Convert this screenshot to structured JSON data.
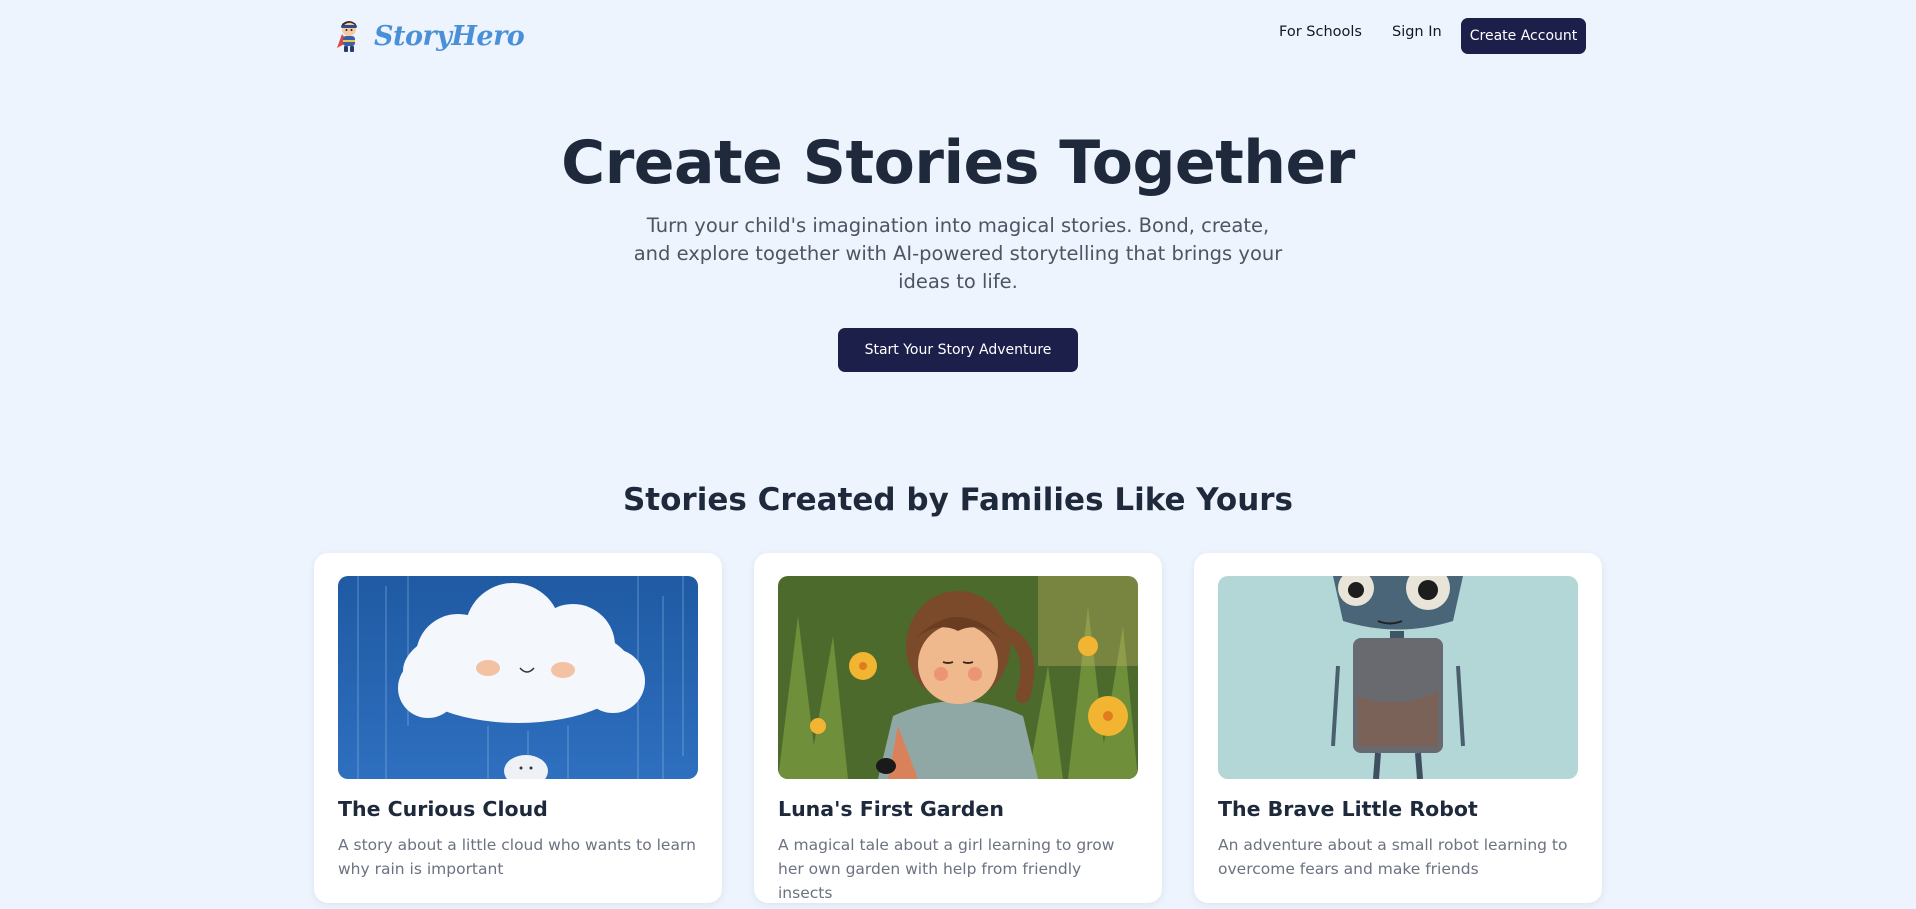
{
  "nav": {
    "brand": "StoryHero",
    "for_schools": "For Schools",
    "sign_in": "Sign In",
    "create_account": "Create Account"
  },
  "hero": {
    "title": "Create Stories Together",
    "subtitle": "Turn your child's imagination into magical stories. Bond, create, and explore together with AI-powered storytelling that brings your ideas to life.",
    "cta": "Start Your Story Adventure"
  },
  "stories_section": {
    "heading": "Stories Created by Families Like Yours",
    "cards": [
      {
        "title": "The Curious Cloud",
        "description": "A story about a little cloud who wants to learn why rain is important",
        "image": "cloud-illustration"
      },
      {
        "title": "Luna's First Garden",
        "description": "A magical tale about a girl learning to grow her own garden with help from friendly insects",
        "image": "girl-garden-illustration"
      },
      {
        "title": "The Brave Little Robot",
        "description": "An adventure about a small robot learning to overcome fears and make friends",
        "image": "robot-illustration"
      }
    ]
  },
  "colors": {
    "background": "#eef4fd",
    "primary_button": "#1b1f4a",
    "brand": "#4a90d9",
    "heading": "#1e293b",
    "muted_text": "#6b7280"
  }
}
